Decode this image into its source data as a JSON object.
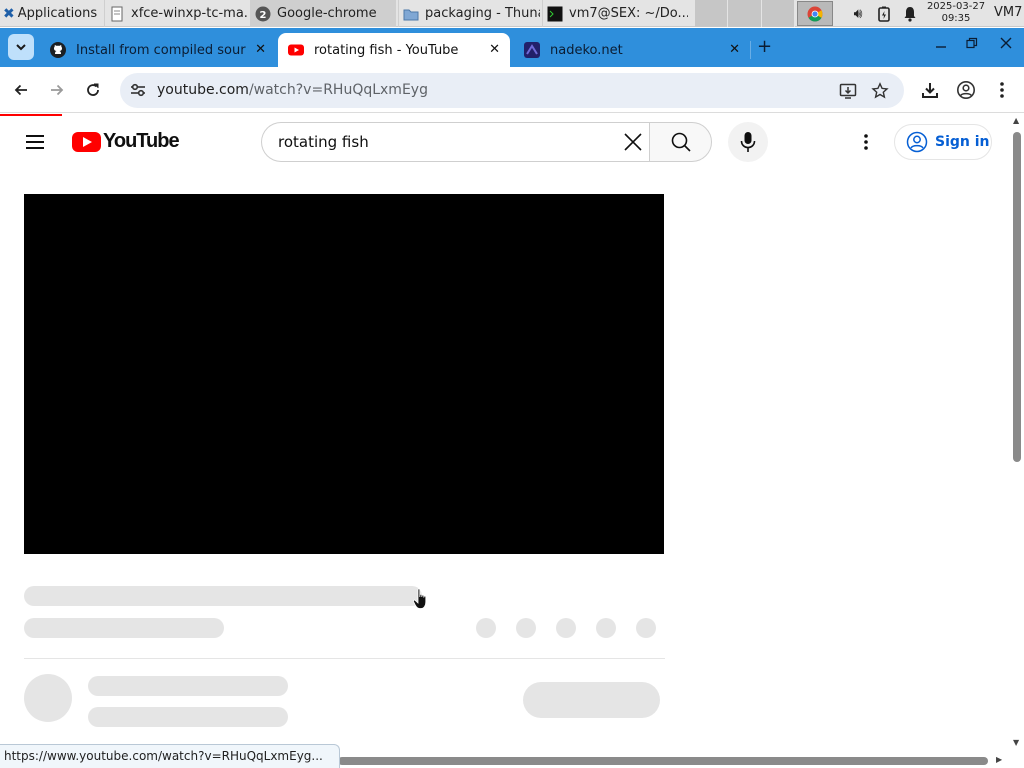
{
  "panel": {
    "apps_label": "Applications",
    "tasks": [
      {
        "label": "xfce-winxp-tc-ma..."
      },
      {
        "label": "Google-chrome",
        "badge": "2"
      },
      {
        "label": "packaging - Thunar"
      },
      {
        "label": "vm7@SEX: ~/Do..."
      }
    ],
    "clock_date": "2025-03-27",
    "clock_time": "09:35",
    "host": "VM7"
  },
  "browser": {
    "tabs": [
      {
        "title": "Install from compiled sour",
        "favicon": "github-icon"
      },
      {
        "title": "rotating fish - YouTube",
        "favicon": "youtube-icon"
      },
      {
        "title": "nadeko.net",
        "favicon": "nadeko-icon"
      }
    ],
    "close_glyph": "✕",
    "new_tab_glyph": "+",
    "url_host": "youtube.com",
    "url_path": "/watch?v=RHuQqLxmEyg",
    "status_url": "https://www.youtube.com/watch?v=RHuQqLxmEyg..."
  },
  "youtube": {
    "logo_text": "YouTube",
    "search_query": "rotating fish",
    "sign_in_label": "Sign in"
  },
  "colors": {
    "tabstrip": "#2f8fdc",
    "youtube_red": "#ff0000",
    "signin_blue": "#065fd4",
    "skeleton": "#e5e5e5"
  }
}
